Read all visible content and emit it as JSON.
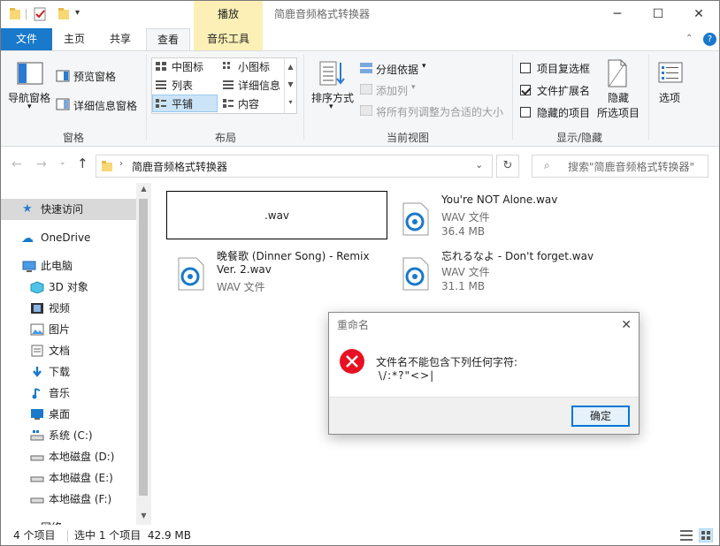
{
  "window": {
    "title": "简鹿音频格式转换器",
    "context_tab": "播放"
  },
  "tabs": [
    "文件",
    "主页",
    "共享",
    "查看",
    "音乐工具"
  ],
  "ribbon": {
    "pane": {
      "nav_pane": "导航窗格",
      "preview": "预览窗格",
      "details": "详细信息窗格",
      "label": "窗格"
    },
    "layout": {
      "medium": "中图标",
      "small": "小图标",
      "list": "列表",
      "details": "详细信息",
      "tiles": "平铺",
      "content": "内容",
      "label": "布局"
    },
    "view": {
      "sort": "排序方式",
      "group": "分组依据",
      "add_column": "添加列",
      "fit_columns": "将所有列调整为合适的大小",
      "label": "当前视图"
    },
    "showhide": {
      "checkboxes": "项目复选框",
      "extensions": "文件扩展名",
      "hidden": "隐藏的项目",
      "hide": "隐藏",
      "hide2": "所选项目",
      "label": "显示/隐藏",
      "extensions_checked": true
    },
    "options": "选项"
  },
  "address": {
    "path": "简鹿音频格式转换器",
    "search_placeholder": "搜索\"简鹿音频格式转换器\""
  },
  "nav": {
    "quick_access": "快速访问",
    "onedrive": "OneDrive",
    "this_pc": "此电脑",
    "items": [
      "3D 对象",
      "视频",
      "图片",
      "文档",
      "下载",
      "音乐",
      "桌面",
      "系统 (C:)",
      "本地磁盘 (D:)",
      "本地磁盘 (E:)",
      "本地磁盘 (F:)"
    ],
    "network": "网络"
  },
  "files": [
    {
      "name": ".wav",
      "renaming": true
    },
    {
      "name": "You're NOT Alone.wav",
      "type": "WAV 文件",
      "size": "36.4 MB"
    },
    {
      "name_line1": "晚餐歌 (Dinner Song) - Remix",
      "name_line2": "Ver. 2.wav",
      "type": "WAV 文件"
    },
    {
      "name": "忘れるなよ - Don't forget.wav",
      "type": "WAV 文件",
      "size": "31.1 MB"
    }
  ],
  "status": {
    "count": "4 个项目",
    "selected": "选中 1 个项目  42.9 MB"
  },
  "dialog": {
    "title": "重命名",
    "message": "文件名不能包含下列任何字符:",
    "chars": "\\/:*?\"<>|",
    "ok": "确定"
  }
}
